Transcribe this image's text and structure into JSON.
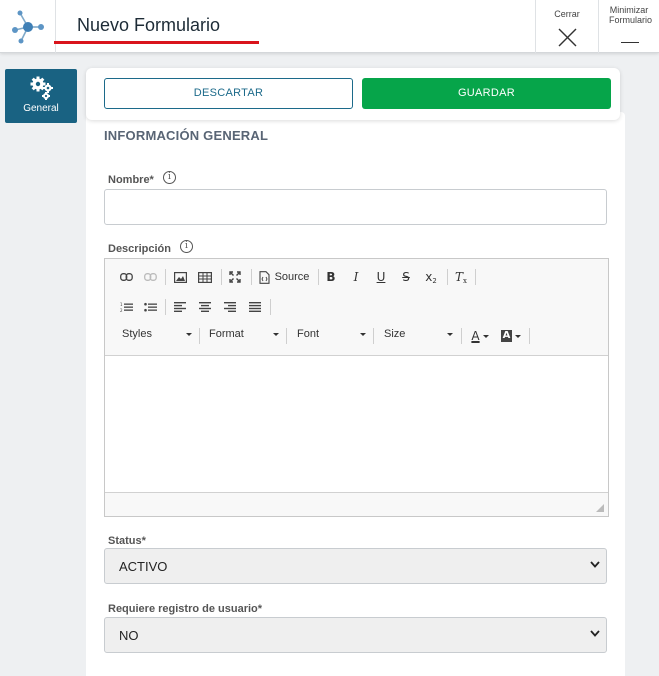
{
  "header": {
    "title": "Nuevo Formulario",
    "close_label": "Cerrar",
    "minimize_label": "Minimizar Formulario",
    "accent_color": "#d9141c"
  },
  "sidebar": {
    "items": [
      {
        "label": "General",
        "icon": "gears-icon",
        "active": true,
        "color": "#196282"
      }
    ]
  },
  "actions": {
    "discard_label": "DESCARTAR",
    "save_label": "GUARDAR",
    "save_color": "#06a54a"
  },
  "form": {
    "section_title": "INFORMACIÓN GENERAL",
    "name_label": "Nombre*",
    "name_value": "",
    "description_label": "Descripción",
    "editor": {
      "source_label": "Source",
      "styles_label": "Styles",
      "format_label": "Format",
      "font_label": "Font",
      "size_label": "Size",
      "content": ""
    },
    "status_label": "Status*",
    "status_value": "ACTIVO",
    "user_registration_label": "Requiere registro de usuario*",
    "user_registration_value": "NO"
  }
}
